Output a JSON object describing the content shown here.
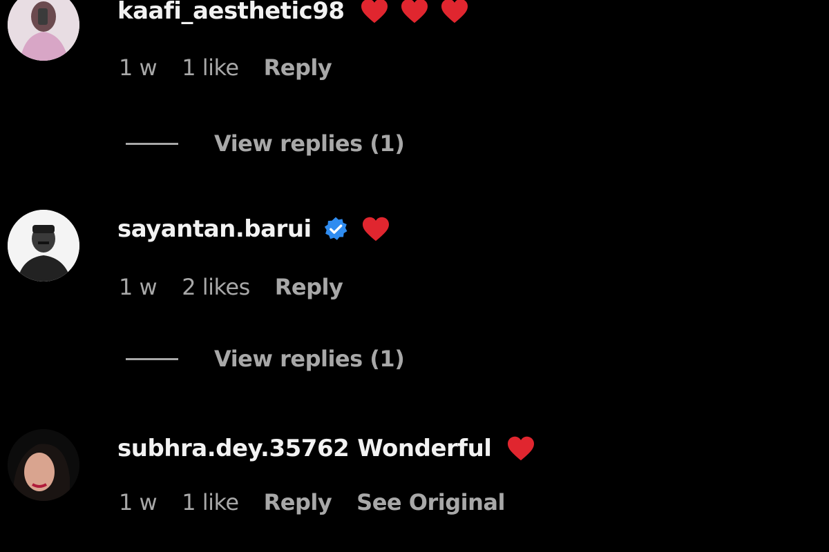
{
  "comments": [
    {
      "username": "kaafi_aesthetic98",
      "text": "",
      "verified": false,
      "hearts": 3,
      "time": "1 w",
      "likes": "1 like",
      "reply_label": "Reply",
      "view_replies": "View replies (1)"
    },
    {
      "username": "sayantan.barui",
      "text": "",
      "verified": true,
      "hearts": 1,
      "time": "1 w",
      "likes": "2 likes",
      "reply_label": "Reply",
      "view_replies": "View replies (1)"
    },
    {
      "username": "subhra.dey.35762",
      "text": "Wonderful",
      "verified": false,
      "hearts": 1,
      "time": "1 w",
      "likes": "1 like",
      "reply_label": "Reply",
      "see_original": "See Original"
    }
  ],
  "colors": {
    "background": "#000000",
    "text_primary": "#f2f2f2",
    "text_secondary": "#a8a8a8",
    "heart": "#e0262f",
    "verified": "#2f8cf0"
  },
  "icons": {
    "heart": "heart-emoji-icon",
    "verified": "verified-badge-icon"
  }
}
